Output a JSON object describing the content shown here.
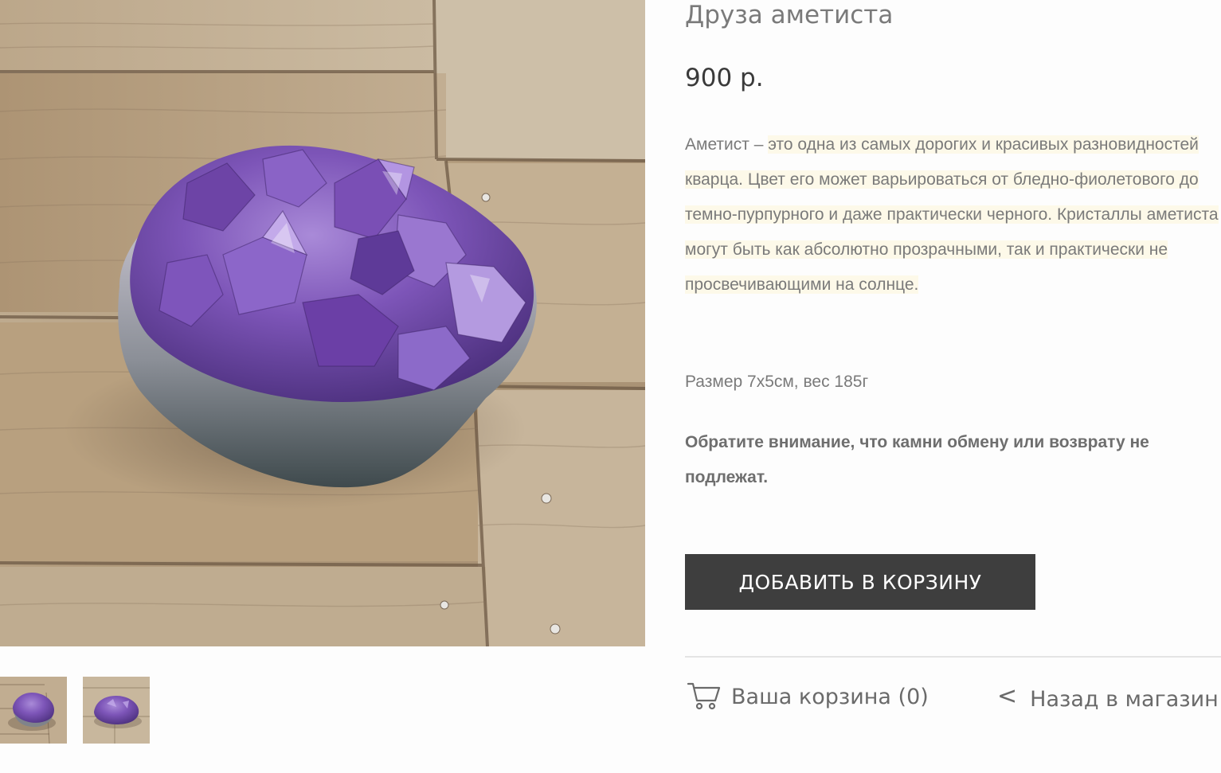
{
  "product": {
    "title": "Друза аметиста",
    "price": "900 р.",
    "description": {
      "lead": "Аметист – ",
      "body": "это одна из самых дорогих и красивых разновидностей кварца. Цвет его может варьироваться от бледно-фиолетового до темно-пурпурного и даже практически черного. Кристаллы аметиста могут быть как абсолютно прозрачными, так и практически не просвечивающими на солнце."
    },
    "spec": "Размер 7х5см, вес 185г",
    "note": "Обратите внимание, что камни обмену или возврату не подлежат."
  },
  "actions": {
    "add_to_cart": "ДОБАВИТЬ В КОРЗИНУ",
    "cart": "Ваша корзина (0)",
    "back_chevron": "<",
    "back": "Назад в магазин"
  },
  "gallery": {
    "main_image": "amethyst-cluster-photo",
    "thumbnails": [
      "amethyst-cluster-thumb-1",
      "amethyst-cluster-thumb-2"
    ]
  },
  "colors": {
    "button_bg": "#3e3e3e",
    "text_gray": "#7a7a7a",
    "price_text": "#3a3a3a",
    "highlight": "#fdf9e9",
    "amethyst": "#7c4fb0",
    "wood": "#b09a7c"
  },
  "icons": {
    "cart": "shopping-cart-icon",
    "back": "chevron-left-icon"
  }
}
